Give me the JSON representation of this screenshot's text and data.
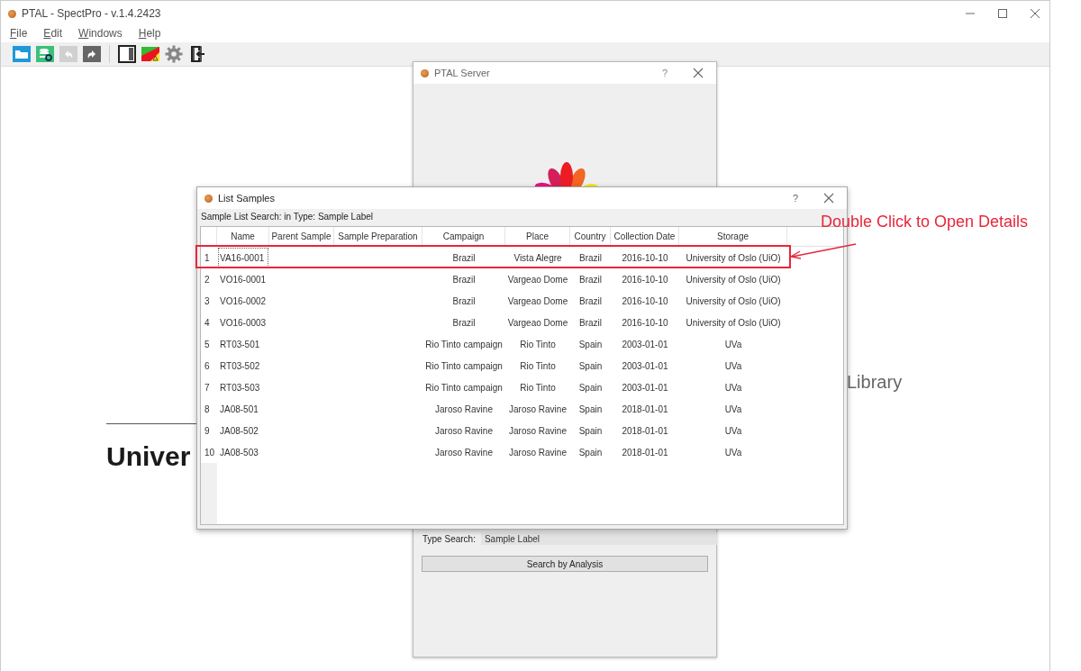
{
  "app": {
    "title": "PTAL - SpectPro -  v.1.4.2423",
    "menu": [
      "File",
      "Edit",
      "Windows",
      "Help"
    ],
    "toolbar": [
      {
        "kind": "folder",
        "disabled": false
      },
      {
        "kind": "database",
        "disabled": false
      },
      {
        "kind": "undo",
        "disabled": true
      },
      {
        "kind": "redo",
        "disabled": false
      },
      {
        "kind": "separator"
      },
      {
        "kind": "panel",
        "disabled": false
      },
      {
        "kind": "flag",
        "disabled": false
      },
      {
        "kind": "gear",
        "disabled": false
      },
      {
        "kind": "exit",
        "disabled": false
      }
    ],
    "background": {
      "left_text": "Univer",
      "right_text": "Library"
    }
  },
  "server_dialog": {
    "title": "PTAL Server",
    "help": "?",
    "type_search_label": "Type Search:",
    "type_search_value": "Sample Label",
    "button": "Search by Analysis"
  },
  "list_dialog": {
    "title": "List Samples",
    "help": "?",
    "search_label": "Sample List Search:  in Type: Sample Label",
    "columns": [
      "Name",
      "Parent Sample",
      "Sample Preparation",
      "Campaign",
      "Place",
      "Country",
      "Collection Date",
      "Storage"
    ],
    "rows": [
      {
        "number": "1",
        "selected": true,
        "cells": [
          "VA16-0001",
          "",
          "",
          "Brazil",
          "Vista Alegre",
          "Brazil",
          "2016-10-10",
          "University of Oslo (UiO)"
        ]
      },
      {
        "number": "2",
        "selected": false,
        "cells": [
          "VO16-0001",
          "",
          "",
          "Brazil",
          "Vargeao Dome",
          "Brazil",
          "2016-10-10",
          "University of Oslo (UiO)"
        ]
      },
      {
        "number": "3",
        "selected": false,
        "cells": [
          "VO16-0002",
          "",
          "",
          "Brazil",
          "Vargeao Dome",
          "Brazil",
          "2016-10-10",
          "University of Oslo (UiO)"
        ]
      },
      {
        "number": "4",
        "selected": false,
        "cells": [
          "VO16-0003",
          "",
          "",
          "Brazil",
          "Vargeao Dome",
          "Brazil",
          "2016-10-10",
          "University of Oslo (UiO)"
        ]
      },
      {
        "number": "5",
        "selected": false,
        "cells": [
          "RT03-501",
          "",
          "",
          "Rio Tinto campaign",
          "Rio Tinto",
          "Spain",
          "2003-01-01",
          "UVa"
        ]
      },
      {
        "number": "6",
        "selected": false,
        "cells": [
          "RT03-502",
          "",
          "",
          "Rio Tinto campaign",
          "Rio Tinto",
          "Spain",
          "2003-01-01",
          "UVa"
        ]
      },
      {
        "number": "7",
        "selected": false,
        "cells": [
          "RT03-503",
          "",
          "",
          "Rio Tinto campaign",
          "Rio Tinto",
          "Spain",
          "2003-01-01",
          "UVa"
        ]
      },
      {
        "number": "8",
        "selected": false,
        "cells": [
          "JA08-501",
          "",
          "",
          "Jaroso Ravine",
          "Jaroso Ravine",
          "Spain",
          "2018-01-01",
          "UVa"
        ]
      },
      {
        "number": "9",
        "selected": false,
        "cells": [
          "JA08-502",
          "",
          "",
          "Jaroso Ravine",
          "Jaroso Ravine",
          "Spain",
          "2018-01-01",
          "UVa"
        ]
      },
      {
        "number": "10",
        "selected": false,
        "cells": [
          "JA08-503",
          "",
          "",
          "Jaroso Ravine",
          "Jaroso Ravine",
          "Spain",
          "2018-01-01",
          "UVa"
        ]
      }
    ]
  },
  "annotation": {
    "text": "Double Click to Open Details"
  }
}
